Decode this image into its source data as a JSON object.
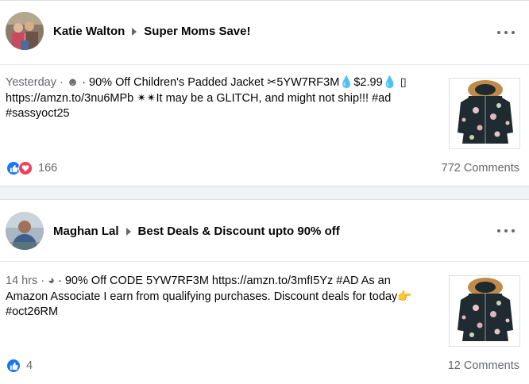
{
  "posts": [
    {
      "author": "Katie Walton",
      "group": "Super Moms Save!",
      "time": "Yesterday",
      "separator": "·",
      "text_line1": " · 90% Off Children's Padded Jacket ✂5YW7RF3M💧$2.99💧 ▯",
      "text_line2": "https://amzn.to/3nu6MPb ✴✴It may be a GLITCH, and might not ship!!! #ad",
      "text_line3": "#sassyoct25",
      "reaction_count": "166",
      "comments": "772 Comments",
      "privacy_icon": "friends-icon"
    },
    {
      "author": "Maghan Lal",
      "group": "Best Deals & Discount upto 90% off",
      "time": "14 hrs",
      "text_line1": " · 90% Off CODE 5YW7RF3M https://amzn.to/3mfI5Yz #AD As an",
      "text_line2": "Amazon Associate I earn from qualifying purchases. Discount deals for today👉",
      "text_line3": "#oct26RM",
      "reaction_count": "4",
      "comments": "12 Comments",
      "privacy_icon": "globe-icon"
    }
  ],
  "colors": {
    "like": "#1877f2",
    "love": "#f33e58",
    "meta": "#65676b"
  }
}
